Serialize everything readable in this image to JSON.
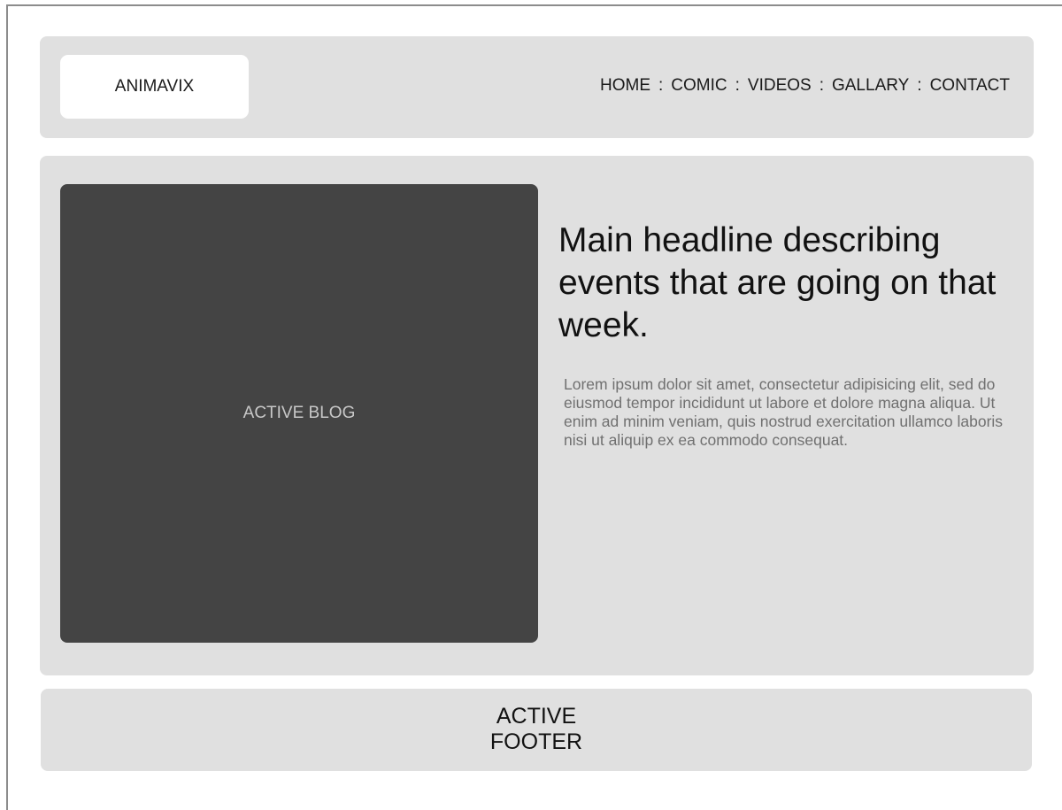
{
  "header": {
    "logo_text": "ANIMAVIX",
    "nav": [
      {
        "label": "HOME"
      },
      {
        "label": "COMIC"
      },
      {
        "label": "VIDEOS"
      },
      {
        "label": "GALLARY"
      },
      {
        "label": "CONTACT"
      }
    ],
    "separator": ":"
  },
  "main": {
    "blog_label": "ACTIVE BLOG",
    "headline": "Main headline describing events that are going on that week.",
    "body": "Lorem ipsum dolor sit amet, consectetur adipisicing elit, sed do eiusmod tempor incididunt ut labore et dolore magna aliqua. Ut enim ad minim veniam, quis nostrud exercitation ullamco laboris nisi ut aliquip ex ea commodo consequat."
  },
  "footer": {
    "line1": "ACTIVE",
    "line2": "FOOTER"
  },
  "colors": {
    "panel": "#e0e0e0",
    "blog_box": "#444444",
    "logo_box": "#ffffff"
  }
}
